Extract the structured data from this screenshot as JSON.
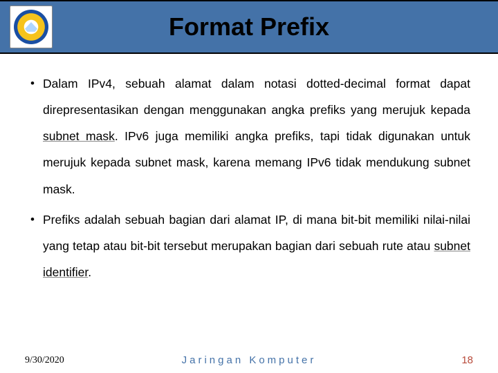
{
  "header": {
    "title": "Format Prefix",
    "logo_alt": "University logo"
  },
  "bullets": [
    {
      "pre1": "Dalam IPv4, sebuah alamat dalam notasi dotted-decimal format dapat direpresentasikan dengan menggunakan angka prefiks yang merujuk kepada ",
      "u1": "subnet mask",
      "post1": ". IPv6 juga memiliki angka prefiks, tapi tidak digunakan untuk merujuk kepada subnet mask, karena memang IPv6 tidak mendukung subnet mask."
    },
    {
      "pre1": "Prefiks adalah sebuah bagian dari alamat IP, di mana bit-bit memiliki nilai-nilai yang tetap atau bit-bit tersebut merupakan bagian dari sebuah rute atau ",
      "u1": "subnet identifier",
      "post1": "."
    }
  ],
  "footer": {
    "date": "9/30/2020",
    "center": "Jaringan Komputer",
    "page": "18"
  }
}
